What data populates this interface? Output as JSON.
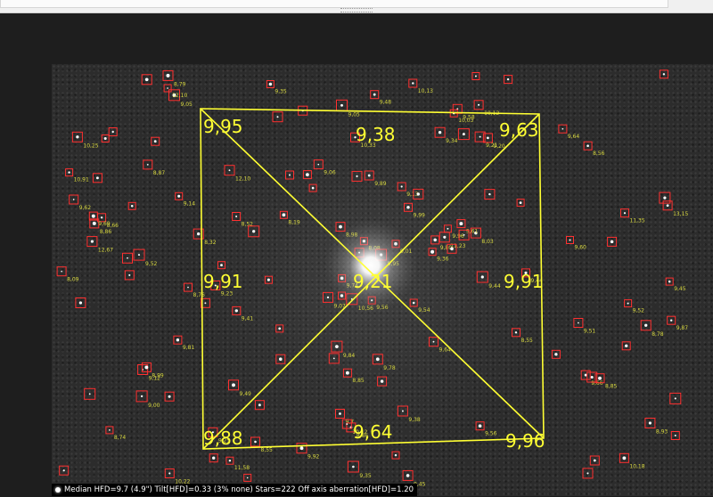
{
  "colors": {
    "tilt_overlay": "#ffff33",
    "star_markers": "#ff3030",
    "star_labels": "#d8d840",
    "status_text": "#ffffff"
  },
  "tilt_overlay": {
    "top_left": "9,95",
    "top": "9,38",
    "top_right": "9,63",
    "left": "9,91",
    "center": "9,21",
    "right": "9,91",
    "bottom_left": "9,88",
    "bottom": "9,64",
    "bottom_right": "9,96"
  },
  "star_labels": [
    "9,56",
    "9,74",
    "9,80",
    "10,12",
    "9,20",
    "9,05",
    "9,52",
    "9,07",
    "10,22",
    "9,99",
    "8,19",
    "9,25",
    "11,23",
    "8,87",
    "12,67",
    "13,15",
    "9,7",
    "12,10",
    "9,49",
    "8,93",
    "10,13",
    "8,32",
    "11,58",
    "9,36",
    "8,86",
    "9,00",
    "10,25",
    "9,56",
    "12,10",
    "9,38",
    "9,48",
    "8,66",
    "9,64",
    "9,58",
    "8,08",
    "8,85",
    "8,55",
    "8,74",
    "9,14",
    "8,98",
    "9,01",
    "9,44",
    "9,35",
    "9,78",
    "9,45",
    "9,05",
    "8,03",
    "9,95",
    "8,86",
    "9,21",
    "8,76",
    "9,45",
    "9,81",
    "8,55",
    "8,56",
    "9,52",
    "9,89",
    "9,35",
    "10,56",
    "9,06",
    "9,12",
    "9,13",
    "9,44",
    "10,18",
    "9,60",
    "8,99",
    "8,52",
    "8,78",
    "9,41",
    "9,87",
    "9,54",
    "9,66",
    "9,96",
    "9,92",
    "10,12",
    "11,35",
    "9,69",
    "9,51",
    "10,33",
    "9,23",
    "9,64",
    "8,09",
    "10,03",
    "9,84",
    "8,79",
    "8,85",
    "9,62",
    "9,61",
    "9,34",
    "10,91"
  ],
  "status_bar": {
    "text": "Median HFD=9.7 (4.9\")  Tilt[HFD]=0.33 (3% none)  Stars=222  Off axis aberration[HFD]=1.20"
  }
}
